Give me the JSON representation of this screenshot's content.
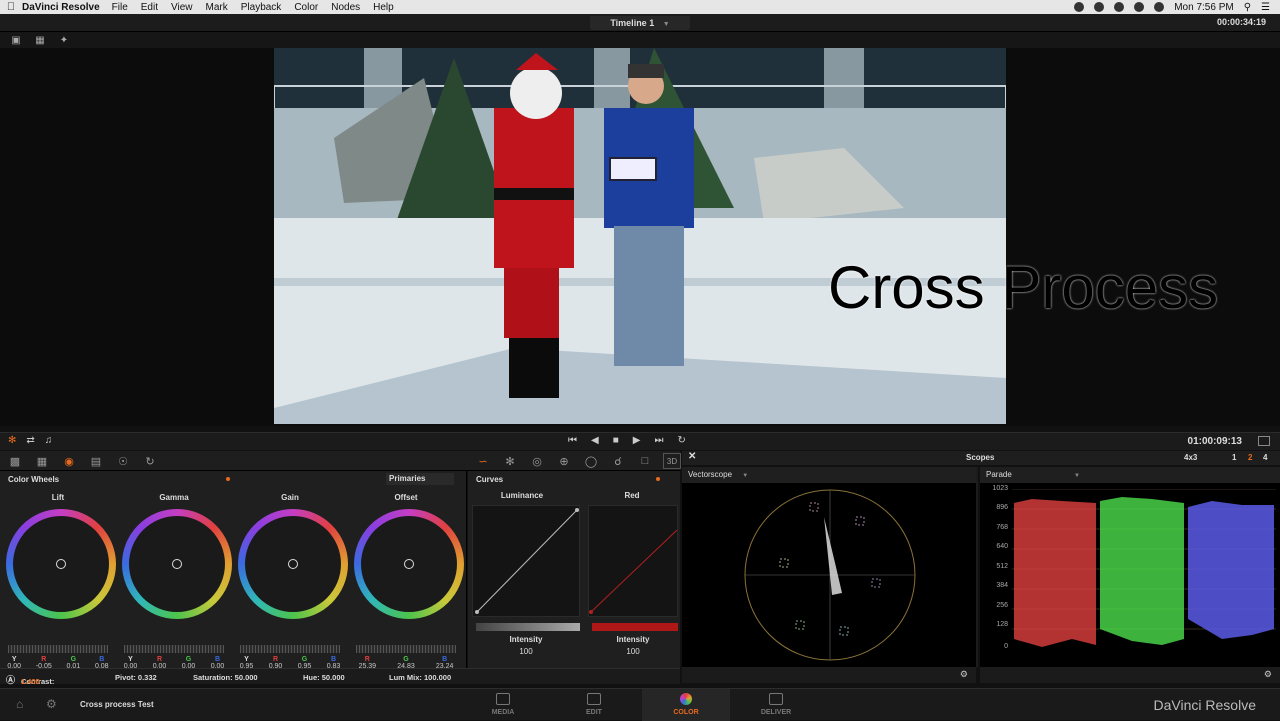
{
  "menubar": {
    "app_name": "DaVinci Resolve",
    "menus": [
      "File",
      "Edit",
      "View",
      "Mark",
      "Playback",
      "Color",
      "Nodes",
      "Help"
    ],
    "clock": "Mon 7:56 PM"
  },
  "topbar": {
    "timeline_name": "Timeline 1",
    "timecode": "00:00:34:19"
  },
  "viewer": {
    "overlay_text": "Cross Process"
  },
  "transport": {
    "timecode": "01:00:09:13"
  },
  "color_wheels": {
    "panel_title": "Color Wheels",
    "mode": "Primaries",
    "wheels": [
      {
        "name": "Lift",
        "values": [
          {
            "label": "Y",
            "value": "0.00"
          },
          {
            "label": "R",
            "value": "-0.05"
          },
          {
            "label": "G",
            "value": "0.01"
          },
          {
            "label": "B",
            "value": "0.08"
          }
        ]
      },
      {
        "name": "Gamma",
        "values": [
          {
            "label": "Y",
            "value": "0.00"
          },
          {
            "label": "R",
            "value": "0.00"
          },
          {
            "label": "G",
            "value": "0.00"
          },
          {
            "label": "B",
            "value": "0.00"
          }
        ]
      },
      {
        "name": "Gain",
        "values": [
          {
            "label": "Y",
            "value": "0.95"
          },
          {
            "label": "R",
            "value": "0.90"
          },
          {
            "label": "G",
            "value": "0.95"
          },
          {
            "label": "B",
            "value": "0.83"
          }
        ]
      },
      {
        "name": "Offset",
        "values": [
          {
            "label": "R",
            "value": "25.39"
          },
          {
            "label": "G",
            "value": "24.83"
          },
          {
            "label": "B",
            "value": "23.24"
          }
        ]
      }
    ],
    "footer": {
      "contrast_label": "Contrast:",
      "contrast_value": "1.400",
      "pivot": "Pivot: 0.332",
      "saturation": "Saturation: 50.000",
      "hue": "Hue: 50.000",
      "lum_mix": "Lum Mix: 100.000"
    }
  },
  "curves": {
    "panel_title": "Curves",
    "luminance": {
      "title": "Luminance",
      "label": "Intensity",
      "value": "100"
    },
    "red": {
      "title": "Red",
      "label": "Intensity",
      "value": "100"
    }
  },
  "scopes": {
    "title": "Scopes",
    "layout": "4x3",
    "pages": [
      "1",
      "2",
      "4"
    ],
    "vectorscope_label": "Vectorscope",
    "parade_label": "Parade",
    "parade_ticks": [
      "1023",
      "896",
      "768",
      "640",
      "512",
      "384",
      "256",
      "128",
      "0"
    ]
  },
  "bottom_nav": {
    "project_name": "Cross process Test",
    "tabs": [
      "MEDIA",
      "EDIT",
      "COLOR",
      "DELIVER"
    ],
    "brand": "DaVinci Resolve"
  },
  "colors": {
    "accent": "#e76a1d",
    "red": "#e04040",
    "green": "#4cc44c",
    "blue": "#3a6be0"
  }
}
